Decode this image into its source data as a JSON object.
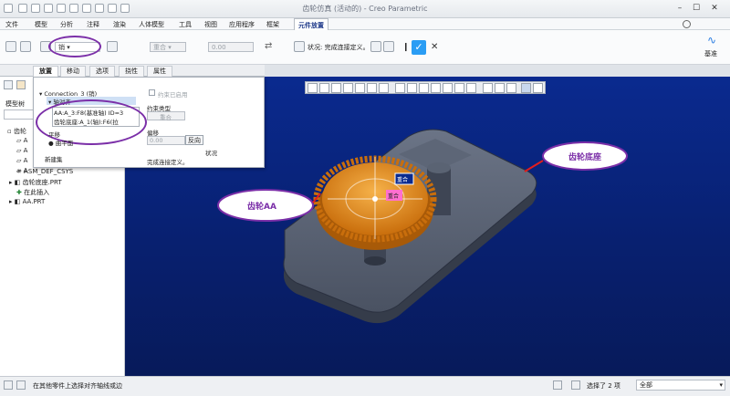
{
  "window": {
    "title": "齿轮仿真 (活动的) - Creo Parametric"
  },
  "menubar": {
    "items": [
      "文件",
      "模型",
      "分析",
      "注释",
      "渲染",
      "人体模型",
      "工具",
      "视图",
      "应用程序",
      "框架"
    ],
    "active_tab": "元件放置"
  },
  "ribbon": {
    "connection_type": "销",
    "constraint_type": "重合",
    "offset_value": "0.00",
    "status_label": "状况: 完成连接定义。",
    "datum_label": "基准"
  },
  "panel_tabs": [
    "放置",
    "移动",
    "选项",
    "挠性",
    "属性"
  ],
  "placement_popup": {
    "connection_header": "Connection_3 (销)",
    "axis_alignment": "轴对齐",
    "ref_1": "AA:A_3:F8(基准轴) ID=3",
    "ref_2": "齿轮底座:A_1(轴):F6(拉",
    "translation": "平移",
    "translation_ref": "曲平面",
    "new_set": "新建集",
    "constraint_enabled": "约束已启用",
    "constraint_type_label": "约束类型",
    "constraint_type_value": "重合",
    "offset_label": "偏移",
    "offset_value": "0.00",
    "reverse_button": "反向",
    "status_label": "状况",
    "status_text": "完成连接定义。"
  },
  "model_tree": {
    "header": "模型树",
    "items": [
      {
        "label": "齿轮",
        "indent": 0
      },
      {
        "label": "A",
        "indent": 1
      },
      {
        "label": "A",
        "indent": 1
      },
      {
        "label": "A",
        "indent": 1
      },
      {
        "label": "A",
        "indent": 1
      },
      {
        "label": "ASM_DEF_CSYS",
        "indent": 1
      },
      {
        "label": "齿轮底座.PRT",
        "indent": 1
      },
      {
        "label": "在此插入",
        "indent": 1
      },
      {
        "label": "AA.PRT",
        "indent": 1
      }
    ]
  },
  "viewport": {
    "callout_gear": "齿轮AA",
    "callout_base": "齿轮底座",
    "tag_coincident_1": "重合",
    "tag_coincident_2": "重合"
  },
  "statusbar": {
    "message": "在其他零件上选择对齐轴线或边",
    "selected": "选择了 2 项",
    "filter": "全部"
  },
  "colors": {
    "viewport_top": "#0a2a8f",
    "gear": "#e08a18",
    "base": "#5a6373",
    "callout": "#7b2fa8",
    "confirm": "#2a9df4"
  }
}
